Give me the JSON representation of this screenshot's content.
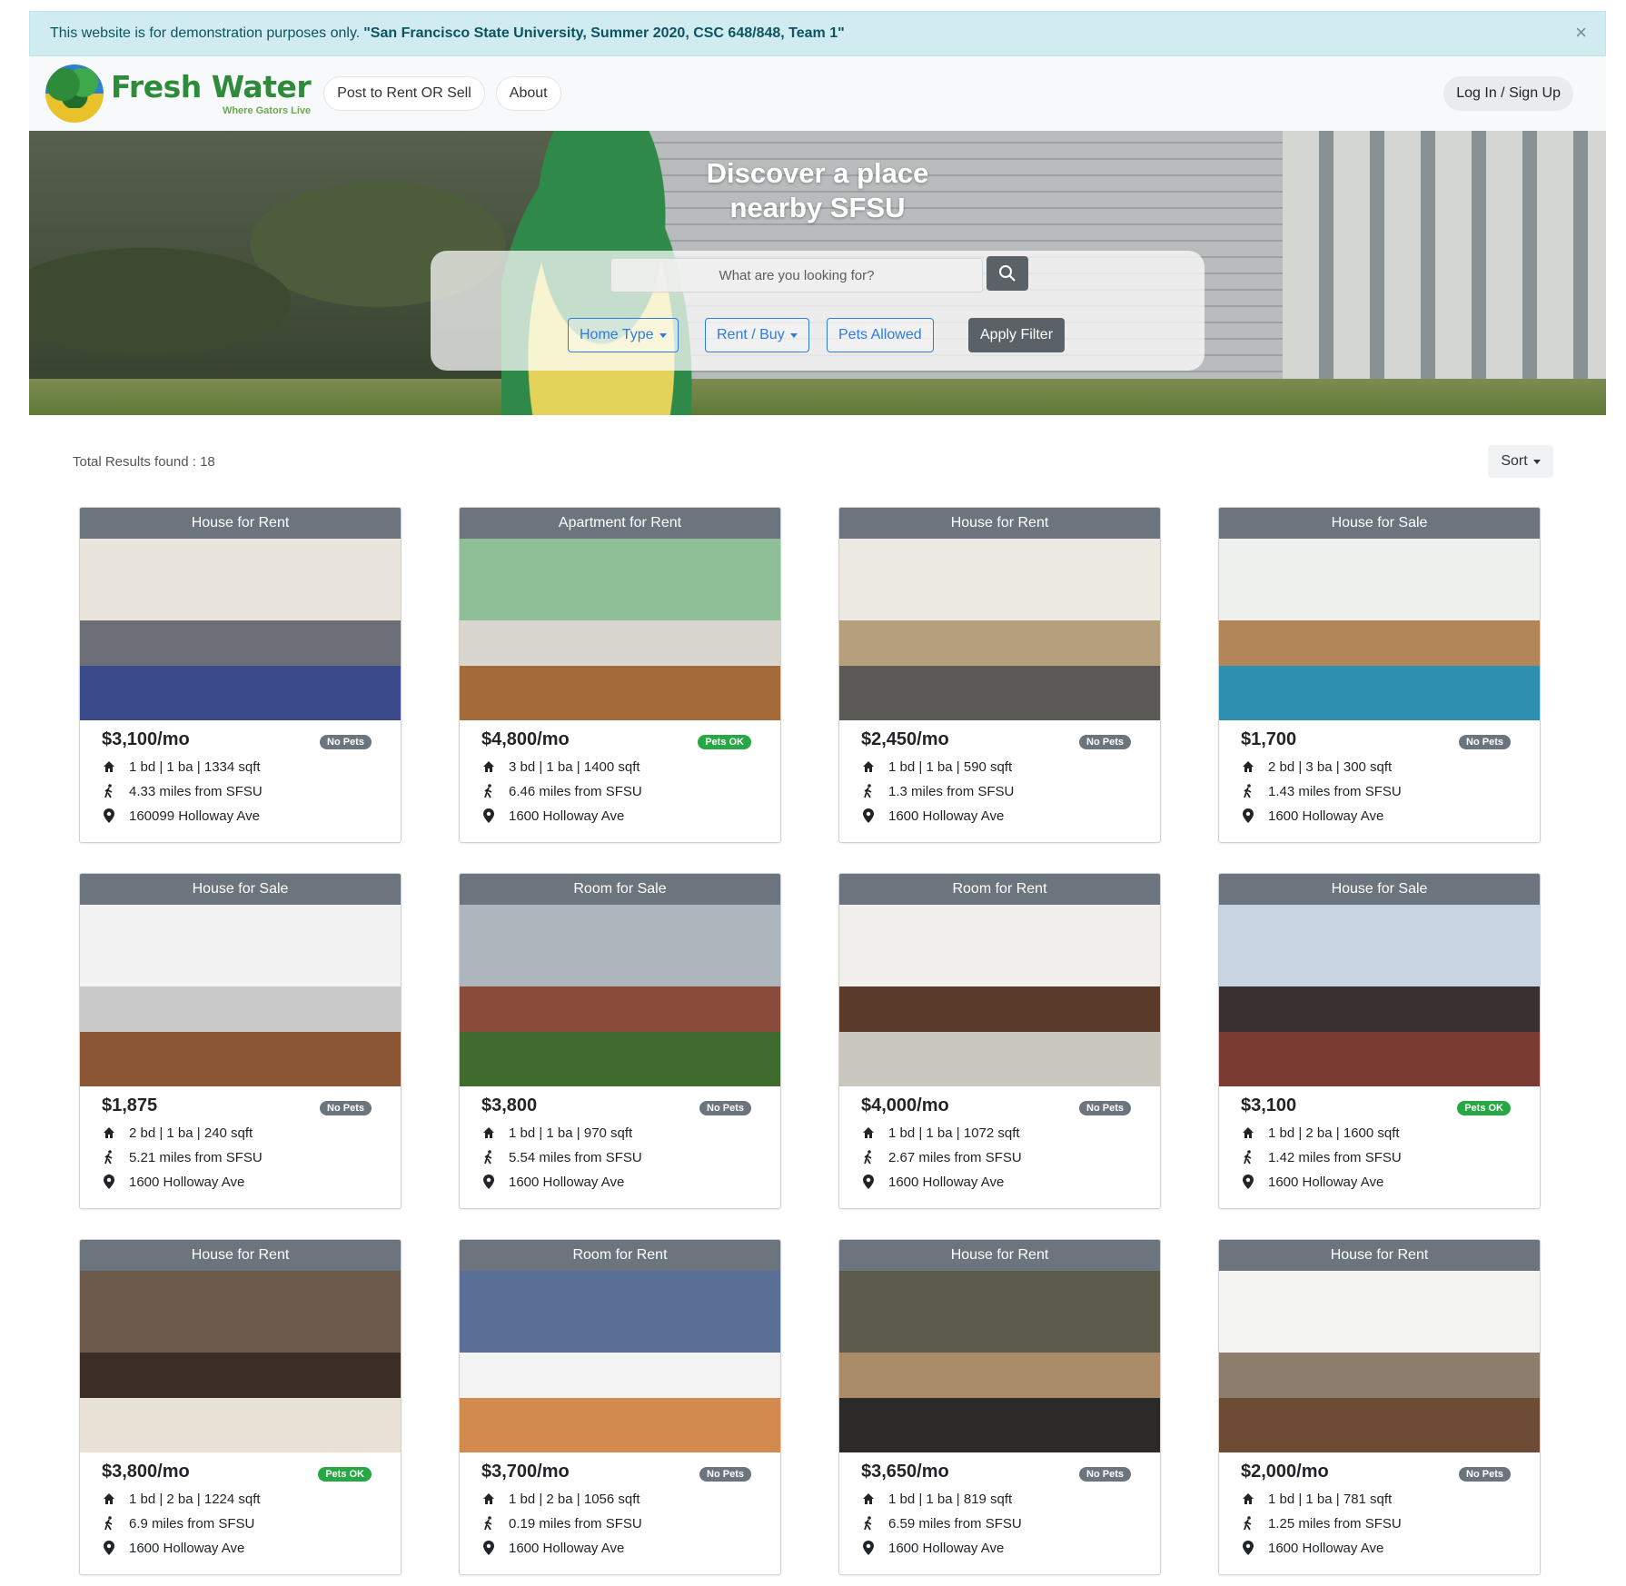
{
  "banner": {
    "text": "This website is for demonstration purposes only.",
    "highlight": "\"San Francisco State University, Summer 2020, CSC 648/848, Team 1\"",
    "close": "×"
  },
  "navbar": {
    "logo_title": "Fresh Water",
    "logo_tagline": "Where Gators Live",
    "links": [
      "Post to Rent OR Sell",
      "About"
    ],
    "login": "Log In / Sign Up"
  },
  "hero": {
    "title_line1": "Discover a place",
    "title_line2": "nearby SFSU",
    "search_placeholder": "What are you looking for?",
    "filters": {
      "home_type": "Home Type",
      "rent_buy": "Rent / Buy",
      "pets": "Pets Allowed",
      "apply": "Apply Filter"
    }
  },
  "results": {
    "total": "Total Results found : 18",
    "sort": "Sort"
  },
  "listings": [
    {
      "type": "House for Rent",
      "price": "$3,100/mo",
      "pets": "No Pets",
      "pets_ok": false,
      "specs": "1 bd | 1 ba | 1334 sqft",
      "distance": "4.33 miles from SFSU",
      "address": "160099 Holloway Ave",
      "img": [
        "#e9e4dc",
        "#3b4a8a",
        "#6d6f76"
      ]
    },
    {
      "type": "Apartment for Rent",
      "price": "$4,800/mo",
      "pets": "Pets OK",
      "pets_ok": true,
      "specs": "3 bd | 1 ba | 1400 sqft",
      "distance": "6.46 miles from SFSU",
      "address": "1600 Holloway Ave",
      "img": [
        "#8fbf97",
        "#a56a3a",
        "#d9d6cf"
      ]
    },
    {
      "type": "House for Rent",
      "price": "$2,450/mo",
      "pets": "No Pets",
      "pets_ok": false,
      "specs": "1 bd | 1 ba | 590 sqft",
      "distance": "1.3 miles from SFSU",
      "address": "1600 Holloway Ave",
      "img": [
        "#ece9e2",
        "#5a5956",
        "#b59f7c"
      ]
    },
    {
      "type": "House for Sale",
      "price": "$1,700",
      "pets": "No Pets",
      "pets_ok": false,
      "specs": "2 bd | 3 ba | 300 sqft",
      "distance": "1.43 miles from SFSU",
      "address": "1600 Holloway Ave",
      "img": [
        "#eef0ee",
        "#2f8fb0",
        "#b3865a"
      ]
    },
    {
      "type": "House for Sale",
      "price": "$1,875",
      "pets": "No Pets",
      "pets_ok": false,
      "specs": "2 bd | 1 ba | 240 sqft",
      "distance": "5.21 miles from SFSU",
      "address": "1600 Holloway Ave",
      "img": [
        "#f2f2f2",
        "#8a5633",
        "#c9c9c9"
      ]
    },
    {
      "type": "Room for Sale",
      "price": "$3,800",
      "pets": "No Pets",
      "pets_ok": false,
      "specs": "1 bd | 1 ba | 970 sqft",
      "distance": "5.54 miles from SFSU",
      "address": "1600 Holloway Ave",
      "img": [
        "#aeb6bd",
        "#3f6b2f",
        "#8a4b3a"
      ]
    },
    {
      "type": "Room for Rent",
      "price": "$4,000/mo",
      "pets": "No Pets",
      "pets_ok": false,
      "specs": "1 bd | 1 ba | 1072 sqft",
      "distance": "2.67 miles from SFSU",
      "address": "1600 Holloway Ave",
      "img": [
        "#f0efec",
        "#c9c6bf",
        "#5a3b2a"
      ]
    },
    {
      "type": "House for Sale",
      "price": "$3,100",
      "pets": "Pets OK",
      "pets_ok": true,
      "specs": "1 bd | 2 ba | 1600 sqft",
      "distance": "1.42 miles from SFSU",
      "address": "1600 Holloway Ave",
      "img": [
        "#c7d4e2",
        "#7a3b33",
        "#3a3032"
      ]
    },
    {
      "type": "House for Rent",
      "price": "$3,800/mo",
      "pets": "Pets OK",
      "pets_ok": true,
      "specs": "1 bd | 2 ba | 1224 sqft",
      "distance": "6.9 miles from SFSU",
      "address": "1600 Holloway Ave",
      "img": [
        "#6b5a4b",
        "#e8e1d6",
        "#3c2e26"
      ]
    },
    {
      "type": "Room for Rent",
      "price": "$3,700/mo",
      "pets": "No Pets",
      "pets_ok": false,
      "specs": "1 bd | 2 ba | 1056 sqft",
      "distance": "0.19 miles from SFSU",
      "address": "1600 Holloway Ave",
      "img": [
        "#5a6f95",
        "#d38a4f",
        "#f3f3f3"
      ]
    },
    {
      "type": "House for Rent",
      "price": "$3,650/mo",
      "pets": "No Pets",
      "pets_ok": false,
      "specs": "1 bd | 1 ba | 819 sqft",
      "distance": "6.59 miles from SFSU",
      "address": "1600 Holloway Ave",
      "img": [
        "#5c5a4a",
        "#2c2a28",
        "#a98b67"
      ]
    },
    {
      "type": "House for Rent",
      "price": "$2,000/mo",
      "pets": "No Pets",
      "pets_ok": false,
      "specs": "1 bd | 1 ba | 781 sqft",
      "distance": "1.25 miles from SFSU",
      "address": "1600 Holloway Ave",
      "img": [
        "#f4f4f2",
        "#6e4b34",
        "#8c7d6c"
      ]
    }
  ],
  "colors": {
    "accent": "#2f7be0",
    "header_gray": "#6c757d",
    "pets_ok": "#28a745",
    "banner_bg": "#d1ecf1"
  },
  "icons": {
    "specs": "home-icon",
    "distance": "walking-icon",
    "address": "map-pin-icon",
    "search": "search-icon",
    "close": "close-icon"
  }
}
